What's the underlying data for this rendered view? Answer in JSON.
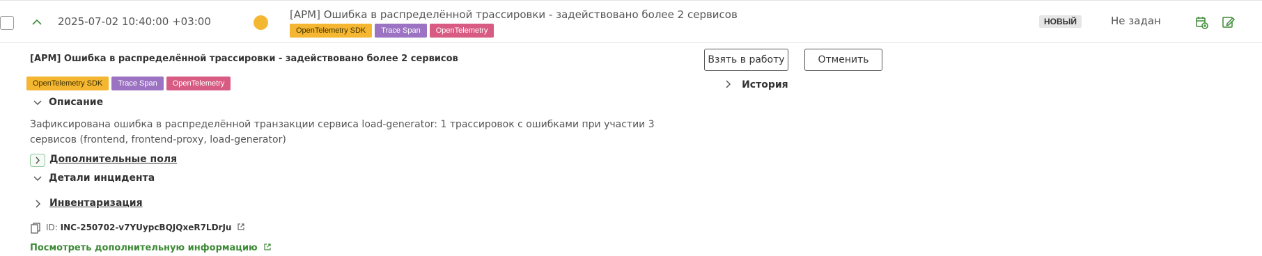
{
  "row": {
    "datetime": "2025-07-02 10:40:00 +03:00",
    "title": "[APM] Ошибка в распределённой трассировки - задействовано более 2 сервисов",
    "tags": [
      {
        "label": "OpenTelemetry SDK",
        "color": "#f5b731"
      },
      {
        "label": "Trace Span",
        "color": "#9b73c2"
      },
      {
        "label": "OpenTelemetry",
        "color": "#d85b83"
      }
    ],
    "status_color": "#f4b731",
    "status_badge": "НОВЫЙ",
    "assignee": "Не задан",
    "icons": [
      "calendar-add-icon",
      "edit-icon"
    ]
  },
  "detail": {
    "title": "[APM] Ошибка в распределённой трассировки - задействовано более 2 сервисов",
    "tags": [
      {
        "label": "OpenTelemetry SDK"
      },
      {
        "label": "Trace Span"
      },
      {
        "label": "OpenTelemetry"
      }
    ],
    "description_label": "Описание",
    "description_text": "Зафиксирована ошибка в распределённой транзакции сервиса load-generator: 1 трассировок с ошибками при участии 3 сервисов (frontend, frontend-proxy, load-generator)",
    "extra_fields_label": "Дополнительные поля",
    "incident_details_label": "Детали инцидента",
    "inventory_label": "Инвентаризация",
    "id_label": "ID:",
    "id_value": "INC-250702-v7YUypcBQJQxeR7LDrJu",
    "more_info_label": "Посмотреть дополнительную информацию"
  },
  "actions": {
    "take_label": "Взять в работу",
    "cancel_label": "Отменить",
    "history_label": "История"
  },
  "colors": {
    "link_green": "#3c8a35",
    "accent_green": "#3c8a35"
  }
}
